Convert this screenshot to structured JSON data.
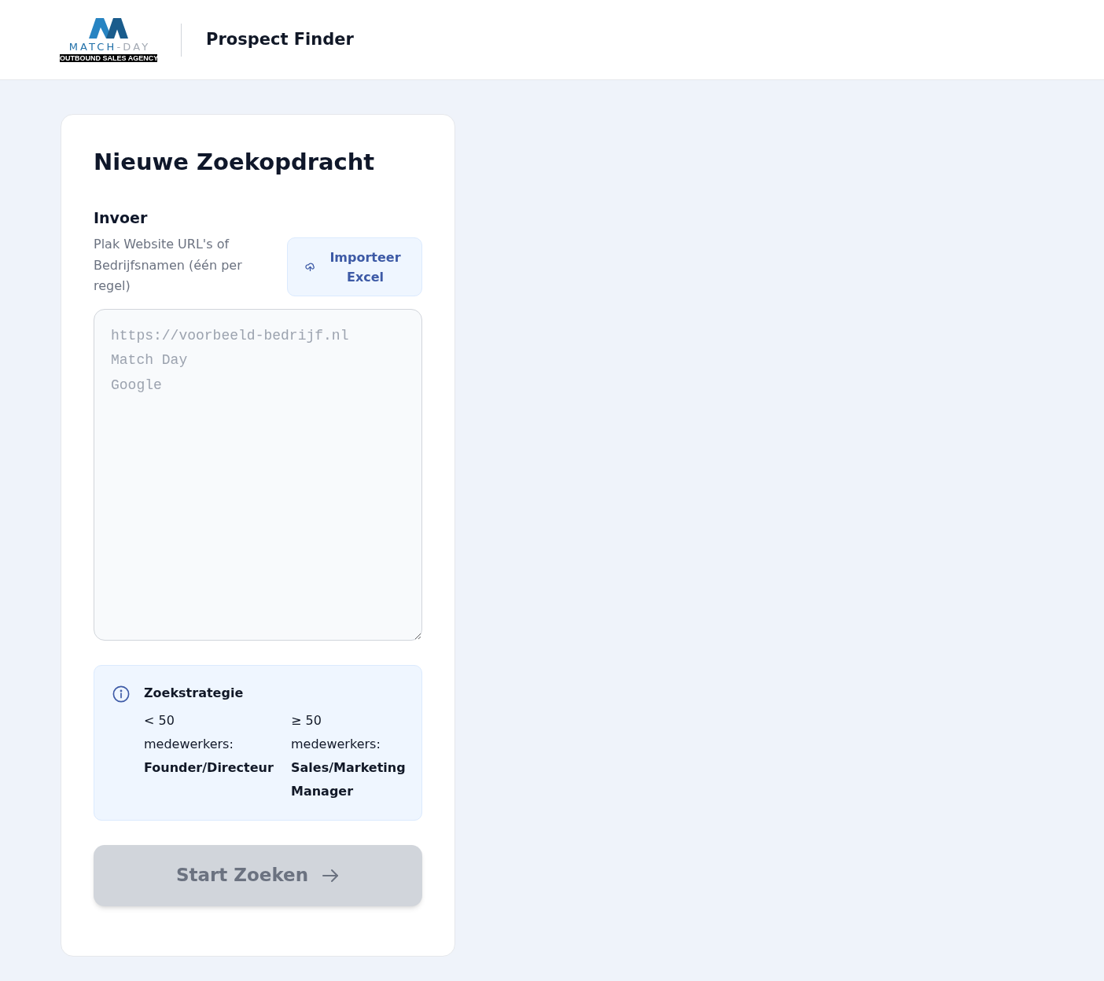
{
  "header": {
    "logo": {
      "name_primary": "MATCH",
      "name_secondary": "-DAY",
      "tagline": "OUTBOUND SALES AGENCY"
    },
    "title": "Prospect Finder"
  },
  "form": {
    "title": "Nieuwe Zoekopdracht",
    "input_label": "Invoer",
    "input_hint": "Plak Website URL's of Bedrijfsnamen (één per regel)",
    "import_button": {
      "label": "Importeer Excel"
    },
    "textarea": {
      "placeholder": "https://voorbeeld-bedrijf.nl\nMatch Day\nGoogle"
    },
    "strategy": {
      "title": "Zoekstrategie",
      "rules": [
        {
          "threshold": "< 50",
          "unit": "medewerkers:",
          "role": "Founder/Directeur"
        },
        {
          "threshold": "≥ 50",
          "unit": "medewerkers:",
          "role": "Sales/Marketing Manager"
        }
      ]
    },
    "start_button": {
      "label": "Start Zoeken",
      "disabled": true
    }
  }
}
